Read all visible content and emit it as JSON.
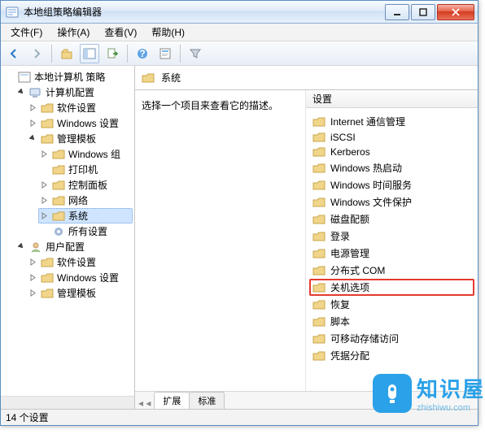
{
  "window_title": "本地组策略编辑器",
  "menu": {
    "file": "文件(F)",
    "action": "操作(A)",
    "view": "查看(V)",
    "help": "帮助(H)"
  },
  "tree": {
    "root": "本地计算机 策略",
    "computer": "计算机配置",
    "software1": "软件设置",
    "windows1": "Windows 设置",
    "templates1": "管理模板",
    "win_comp": "Windows 组",
    "printer": "打印机",
    "ctrl_panel": "控制面板",
    "network": "网络",
    "system": "系统",
    "all": "所有设置",
    "user": "用户配置",
    "software2": "软件设置",
    "windows2": "Windows 设置",
    "templates2": "管理模板"
  },
  "header_title": "系统",
  "desc_hint": "选择一个项目来查看它的描述。",
  "list_header": "设置",
  "settings": [
    "Internet 通信管理",
    "iSCSI",
    "Kerberos",
    "Windows 热启动",
    "Windows 时间服务",
    "Windows 文件保护",
    "磁盘配额",
    "登录",
    "电源管理",
    "分布式 COM",
    "关机选项",
    "恢复",
    "脚本",
    "可移动存储访问",
    "凭据分配"
  ],
  "highlight_index": 10,
  "tabs": {
    "extended": "扩展",
    "standard": "标准"
  },
  "status": "14 个设置",
  "watermark": {
    "brand": "知识屋",
    "url": "zhishiwu.com"
  }
}
